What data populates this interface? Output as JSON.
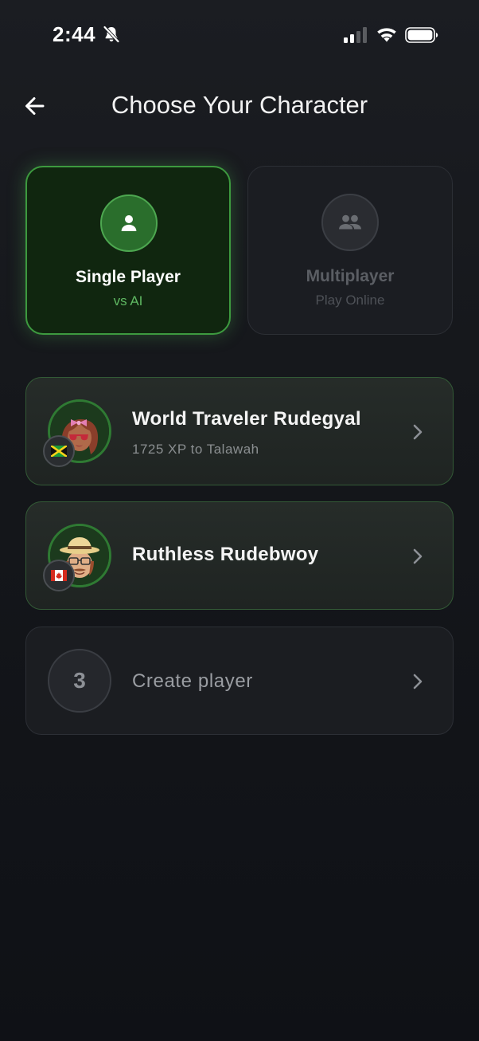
{
  "status_bar": {
    "time": "2:44"
  },
  "header": {
    "title": "Choose Your Character"
  },
  "modes": [
    {
      "label": "Single Player",
      "sublabel": "vs AI",
      "selected": true
    },
    {
      "label": "Multiplayer",
      "sublabel": "Play Online",
      "selected": false
    }
  ],
  "players": [
    {
      "name": "World Traveler Rudegyal",
      "subtitle": "1725 XP to Talawah",
      "flag": "jamaica-flag-icon"
    },
    {
      "name": "Ruthless Rudebwoy",
      "flag": "canada-flag-icon"
    }
  ],
  "create_slot": {
    "number": "3",
    "label": "Create player"
  },
  "colors": {
    "accent_green": "#4da750",
    "selected_card_bg": "#10260f",
    "background": "#15171b"
  }
}
